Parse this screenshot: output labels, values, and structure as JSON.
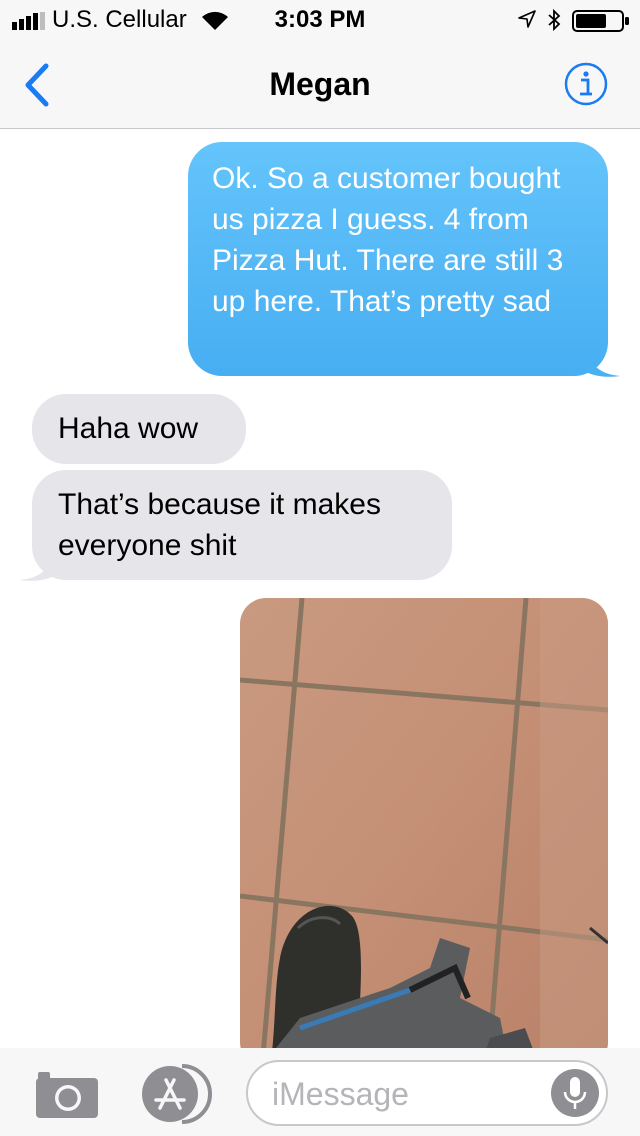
{
  "status_bar": {
    "carrier": "U.S. Cellular",
    "time": "3:03 PM",
    "icons": [
      "signal-icon",
      "wifi-icon",
      "location-arrow-icon",
      "bluetooth-icon",
      "battery-icon"
    ]
  },
  "nav": {
    "contact_name": "Megan",
    "back_icon": "chevron-left-icon",
    "info_icon": "info-icon",
    "accent_color": "#1a7bf2"
  },
  "messages": [
    {
      "direction": "sent",
      "text": "Ok. So a customer bought us pizza I guess. 4 from Pizza Hut. There are still 3 up here. That’s pretty sad"
    },
    {
      "direction": "received",
      "text": "Haha wow"
    },
    {
      "direction": "received",
      "text": "That’s because it makes everyone shit"
    },
    {
      "direction": "sent",
      "type": "photo"
    }
  ],
  "colors": {
    "sent_bubble": "#5ac8fa",
    "received_bubble": "#e5e5ea"
  },
  "input_bar": {
    "placeholder": "iMessage",
    "icons": [
      "camera-icon",
      "app-store-icon",
      "microphone-icon"
    ]
  }
}
